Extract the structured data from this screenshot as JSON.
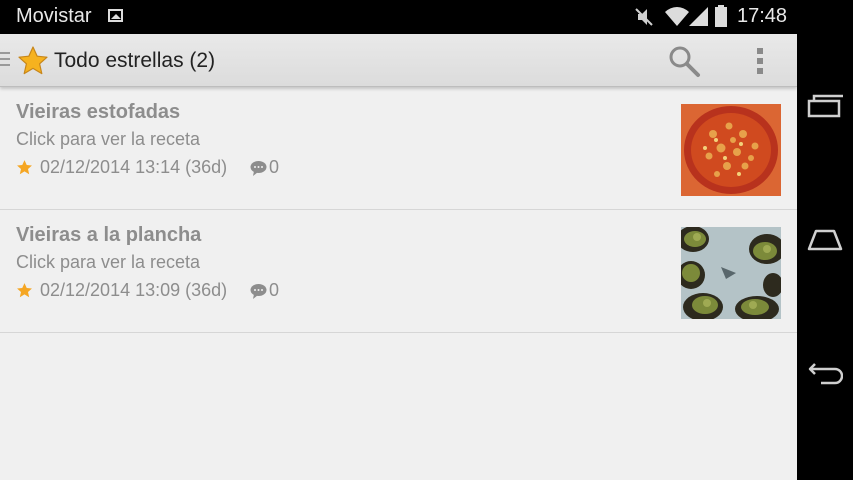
{
  "status_bar": {
    "carrier": "Movistar",
    "time": "17:48",
    "icons": [
      "gallery-icon",
      "mute-icon",
      "wifi-icon",
      "signal-icon",
      "battery-icon"
    ]
  },
  "action_bar": {
    "title": "Todo estrellas (2)",
    "icons": [
      "star-icon",
      "search-icon",
      "overflow-menu-icon"
    ]
  },
  "items": [
    {
      "title": "Vieiras estofadas",
      "subtitle": "Click para ver la receta",
      "date": "02/12/2014 13:14 (36d)",
      "comments": "0",
      "thumbnail": "stew-photo"
    },
    {
      "title": "Vieiras a la plancha",
      "subtitle": "Click para ver la receta",
      "date": "02/12/2014 13:09 (36d)",
      "comments": "0",
      "thumbnail": "grilled-scallops-photo"
    }
  ],
  "nav_bar": {
    "buttons": [
      "recent-apps-icon",
      "home-icon",
      "back-icon"
    ]
  },
  "colors": {
    "action_bar": "#dedede",
    "list_background": "#f0f0f0",
    "accent_star": "#f5a623",
    "secondary_text": "#8d8d8d"
  }
}
